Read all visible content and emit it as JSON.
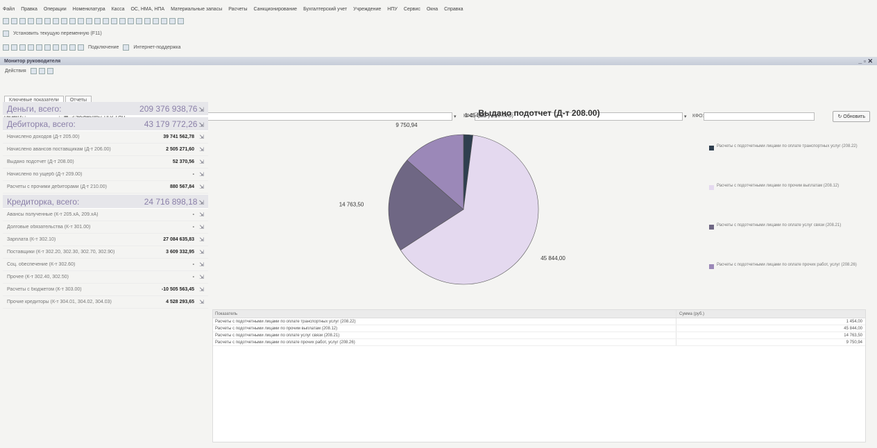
{
  "menubar": [
    "Файл",
    "Правка",
    "Операции",
    "Номенклатура",
    "Касса",
    "ОС, НМА, НПА",
    "Материальные запасы",
    "Расчеты",
    "Санкционирование",
    "Бухгалтерский учет",
    "Учреждение",
    "НПУ",
    "Сервис",
    "Окна",
    "Справка"
  ],
  "toolbar": {
    "set_period": "Установить текущую переменную (F11)",
    "connect": "Подключение",
    "internet": "Интернет-поддержка"
  },
  "window": {
    "title": "Монитор руководителя",
    "actions": "Действия"
  },
  "tabs": [
    "Ключевые показатели",
    "Отчеты"
  ],
  "filter": {
    "date_label": "На дату:",
    "institution_label": "Учреждение:",
    "institution_value": "НПУ РАН",
    "kfo_label": "КФО:",
    "kfo_value": "(без учета КФО)",
    "kfo2_label": "КФО:",
    "refresh": "Обновить"
  },
  "left": {
    "money_label": "Деньги, всего:",
    "money_value": "209 376 938,76",
    "debit_label": "Дебиторка, всего:",
    "debit_value": "43 179 772,26",
    "debit_rows": [
      {
        "label": "Начислено доходов (Д-т 205.00)",
        "value": "39 741 562,78"
      },
      {
        "label": "Начислено авансов поставщикам (Д-т 206.00)",
        "value": "2 505 271,60"
      },
      {
        "label": "Выдано подотчет (Д-т 208.00)",
        "value": "52 370,56"
      },
      {
        "label": "Начислено по ущерб (Д-т 209.00)",
        "value": "-"
      },
      {
        "label": "Расчеты с прочими дебиторами (Д-т 210.00)",
        "value": "880 567,84"
      }
    ],
    "credit_label": "Кредиторка, всего:",
    "credit_value": "24 716 898,18",
    "credit_rows": [
      {
        "label": "Авансы полученные (К-т 205.хА, 209.хА)",
        "value": "-"
      },
      {
        "label": "Долговые обязательства (К-т 301.00)",
        "value": "-"
      },
      {
        "label": "Зарплата (К-т 302.10)",
        "value": "27 084 635,83"
      },
      {
        "label": "Поставщики (К-т 302.20, 302.30, 302.70, 302.90)",
        "value": "3 609 332,95"
      },
      {
        "label": "Соц. обеспечение (К-т 302.60)",
        "value": "-"
      },
      {
        "label": "Прочее (К-т 302.40, 302.50)",
        "value": "-"
      },
      {
        "label": "Расчеты с бюджетом (К-т 303.00)",
        "value": "-10 505 563,45"
      },
      {
        "label": "Прочие кредиторы (К-т 304.01, 304.02, 304.03)",
        "value": "4 528 293,65"
      }
    ]
  },
  "chart_data": {
    "type": "pie",
    "title": "Выдано подотчет (Д-т 208.00)",
    "categories": [
      "Расчеты с подотчетными лицами по оплате транспортных услуг (208.22)",
      "Расчеты с подотчетными лицами по прочим выплатам (208.12)",
      "Расчеты с подотчетными лицами по оплате услуг связи (208.21)",
      "Расчеты с подотчетными лицами по оплате прочих работ, услуг (208.26)"
    ],
    "values": [
      1454.0,
      45844.0,
      14763.5,
      9750.94
    ],
    "data_labels": [
      "1 454,00",
      "45 844,00",
      "14 763,50",
      "9 750,94"
    ],
    "colors": [
      "#2f3f4f",
      "#e4d9ef",
      "#6f6784",
      "#9b88b8"
    ],
    "legend_position": "right"
  },
  "grid": {
    "headers": [
      "Показатель",
      "Сумма (руб.)"
    ],
    "rows": [
      {
        "name": "Расчеты с подотчетными лицами по оплате транспортных услуг (208.22)",
        "value": "1 454,00"
      },
      {
        "name": "Расчеты с подотчетными лицами по прочим выплатам (208.12)",
        "value": "45 844,00"
      },
      {
        "name": "Расчеты с подотчетными лицами по оплате услуг связи (208.21)",
        "value": "14 763,50"
      },
      {
        "name": "Расчеты с подотчетными лицами по оплате прочих работ, услуг (208.26)",
        "value": "9 750,94"
      }
    ]
  }
}
